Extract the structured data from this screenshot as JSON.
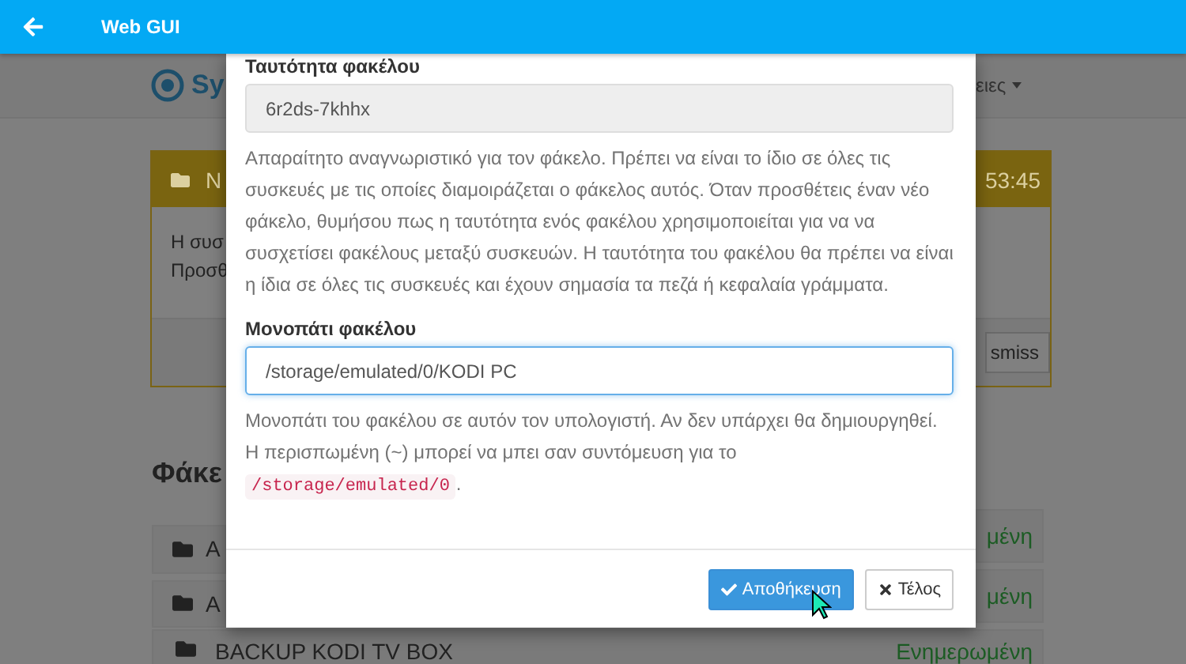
{
  "app_bar": {
    "title": "Web GUI"
  },
  "background": {
    "left": {
      "brand": "Sy",
      "panel_title": "N",
      "panel_lines": [
        "Η συσ",
        "Προσθ"
      ],
      "heading": "Φάκε",
      "rows": [
        "A",
        "A"
      ]
    },
    "right": {
      "nav_menu": "ειες",
      "panel_time": "53:45",
      "dismiss": "smiss",
      "rows": [
        "μένη",
        "μένη"
      ]
    },
    "bottom_row": {
      "name": "BACKUP KODI TV BOX",
      "status": "Ενημερωμένη"
    }
  },
  "dialog": {
    "fields": [
      {
        "label": "Ταυτότητα φακέλου",
        "value": "6r2ds-7khhx",
        "readonly": true,
        "focused": false,
        "help": [
          {
            "kind": "text",
            "text": "Απαραίτητο αναγνωριστικό για τον φάκελο. Πρέπει να είναι το ίδιο σε όλες τις συσκευές με τις οποίες διαμοιράζεται ο φάκελος αυτός. Όταν προσθέτεις έναν νέο φάκελο, θυμήσου πως η ταυτότητα ενός φακέλου χρησιμοποιείται για να να συσχετίσει φακέλους μεταξύ συσκευών. Η ταυτότητα του φακέλου θα πρέπει να είναι η ίδια σε όλες τις συσκευές και έχουν σημασία τα πεζά ή κεφαλαία γράμματα."
          }
        ]
      },
      {
        "label": "Μονοπάτι φακέλου",
        "value": "/storage/emulated/0/KODI PC",
        "readonly": false,
        "focused": true,
        "help": [
          {
            "kind": "text",
            "text": "Μονοπάτι του φακέλου σε αυτόν τον υπολογιστή. Αν δεν υπάρχει θα δημιουργηθεί. Η περισπωμένη (~) μπορεί να μπει σαν συντόμευση για το "
          },
          {
            "kind": "code",
            "text": "/storage/emulated/0"
          },
          {
            "kind": "text",
            "text": "."
          }
        ]
      }
    ],
    "buttons": [
      {
        "label": "Αποθήκευση",
        "kind": "primary"
      },
      {
        "label": "Τέλος",
        "kind": "close"
      }
    ]
  }
}
